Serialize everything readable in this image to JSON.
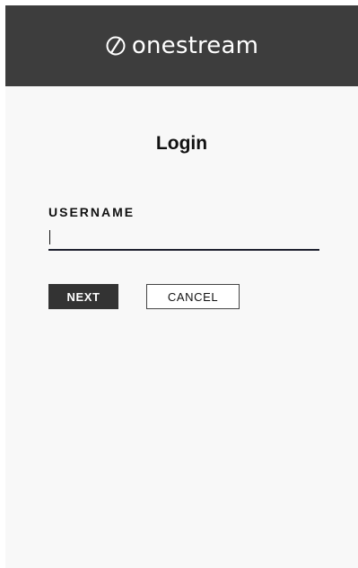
{
  "header": {
    "brand_name": "onestream",
    "logo_icon": "onestream-logo-icon"
  },
  "login": {
    "title": "Login",
    "username_label": "USERNAME",
    "username_value": "",
    "next_label": "NEXT",
    "cancel_label": "CANCEL"
  },
  "colors": {
    "header_bg": "#3d3d3d",
    "panel_bg": "#f8f8f8",
    "primary_button_bg": "#333333",
    "input_underline": "#1f2230"
  }
}
